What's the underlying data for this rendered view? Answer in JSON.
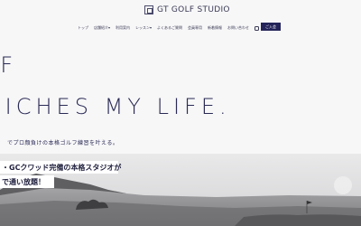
{
  "brand": {
    "name": "GT GOLF STUDIO"
  },
  "nav": {
    "items": [
      "トップ",
      "店舗紹介",
      "利用案内",
      "レッスン",
      "よくあるご質問",
      "会員専用",
      "新着情報",
      "お問い合わせ"
    ],
    "dropdown_markers": [
      "",
      "▾",
      "",
      "▾",
      "",
      "",
      "",
      ""
    ],
    "cta_label": "ご入会"
  },
  "hero": {
    "headline_line1": "LF",
    "headline_line2": "RICHES MY LIFE.",
    "lead": "でプロ顔負けの本格ゴルフ練習を叶える。",
    "tag1": "・GCクワッド完備の本格スタジオが",
    "tag2": "で通い放題！"
  },
  "colors": {
    "accent": "#24245a",
    "text": "#2a2a55",
    "background": "#f7f7f8"
  }
}
